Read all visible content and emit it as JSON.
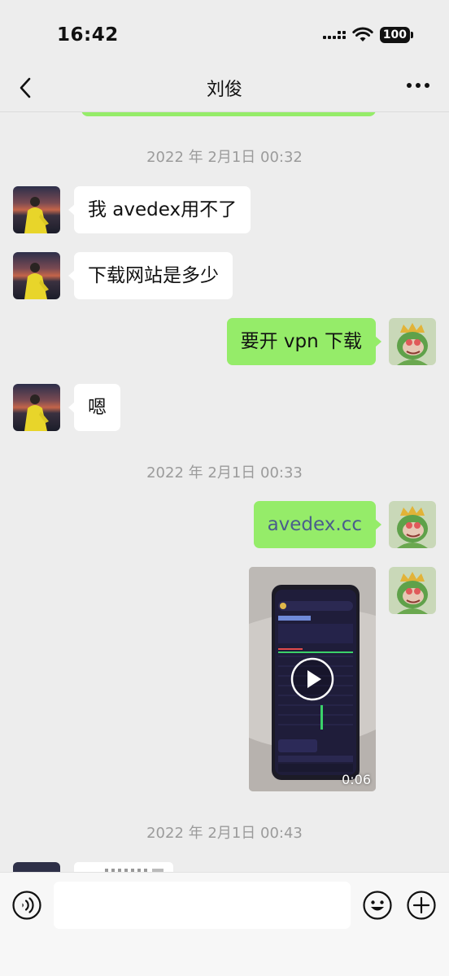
{
  "status_bar": {
    "time": "16:42",
    "battery": "100"
  },
  "header": {
    "title": "刘俊",
    "back_icon": "chevron-left-icon",
    "more_icon": "ellipsis-icon"
  },
  "messages": {
    "ts1": "2022 年 2月1日 00:32",
    "m1": "我 avedex用不了",
    "m2": "下载网站是多少",
    "m3": "要开 vpn 下载",
    "m4": "嗯",
    "ts2": "2022 年 2月1日 00:33",
    "m5": "avedex.cc",
    "video_duration": "0:06",
    "ts3": "2022 年 2月1日 00:43"
  },
  "input_bar": {
    "voice_icon": "voice-icon",
    "emoji_icon": "emoji-icon",
    "plus_icon": "plus-circle-icon",
    "placeholder": ""
  },
  "colors": {
    "background": "#ededed",
    "incoming_bubble": "#ffffff",
    "outgoing_bubble": "#95ec69",
    "timestamp": "#9b9b9b",
    "link": "#4a5d8c"
  }
}
